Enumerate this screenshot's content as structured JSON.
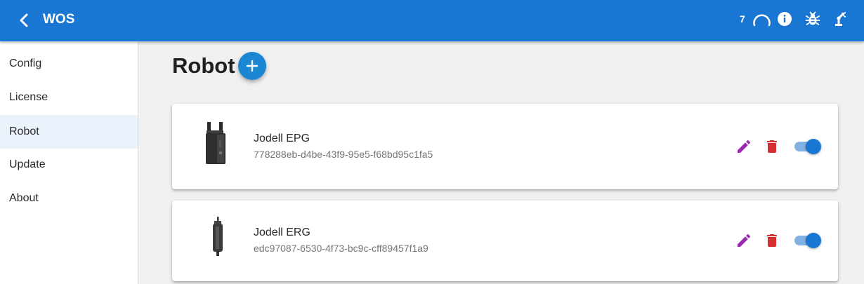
{
  "appbar": {
    "title": "WOS",
    "task_count": "7",
    "icons": [
      "back-chevron-icon",
      "loading-spinner-icon",
      "info-icon",
      "bug-icon",
      "robot-arm-icon"
    ]
  },
  "sidebar": {
    "items": [
      {
        "label": "Config",
        "active": false
      },
      {
        "label": "License",
        "active": false
      },
      {
        "label": "Robot",
        "active": true
      },
      {
        "label": "Update",
        "active": false
      },
      {
        "label": "About",
        "active": false
      }
    ]
  },
  "main": {
    "title": "Robot",
    "robots": [
      {
        "name": "Jodell EPG",
        "id": "778288eb-d4be-43f9-95e5-f68bd95c1fa5",
        "enabled": true
      },
      {
        "name": "Jodell ERG",
        "id": "edc97087-6530-4f73-bc9c-cff89457f1a9",
        "enabled": true
      }
    ]
  },
  "colors": {
    "appbar": "#1976d2",
    "fab": "#1b87d3",
    "edit": "#9c27b0",
    "delete": "#d32f2f",
    "toggle_on": "#1976d2",
    "active_nav": "#eaf2fb"
  }
}
